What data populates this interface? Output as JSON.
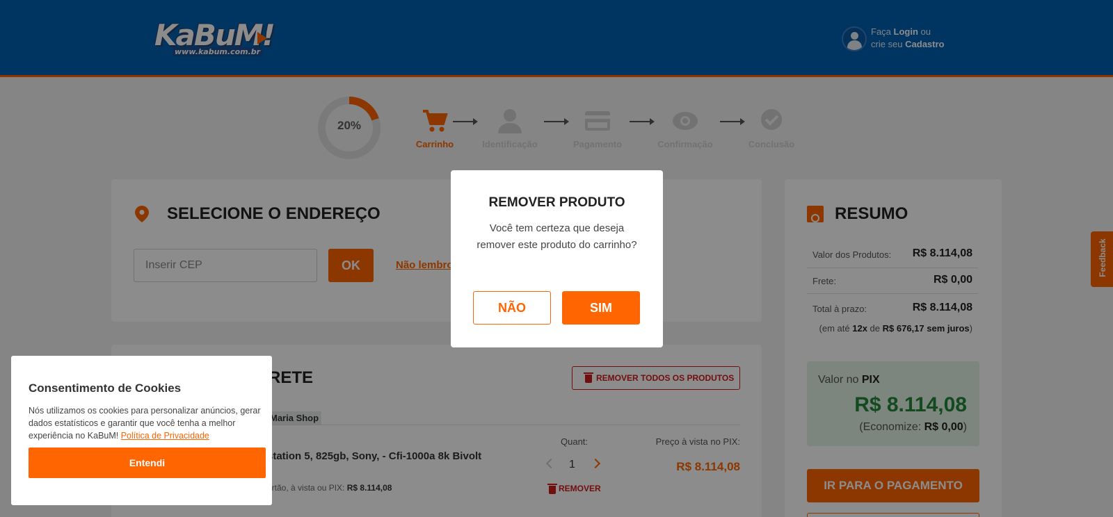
{
  "header": {
    "logo_text": "KaBuM!",
    "logo_url": "www.kabum.com.br",
    "login_prefix": "Faça ",
    "login_link": "Login",
    "login_mid": " ou",
    "login_line2_prefix": "crie seu ",
    "signup_link": "Cadastro"
  },
  "progress": {
    "percent_label": "20%",
    "percent_value": 0.2,
    "steps": [
      {
        "label": "Carrinho",
        "icon": "cart-icon",
        "active": true
      },
      {
        "label": "Identificação",
        "icon": "user-icon",
        "active": false
      },
      {
        "label": "Pagamento",
        "icon": "card-icon",
        "active": false
      },
      {
        "label": "Confirmação",
        "icon": "eye-icon",
        "active": false
      },
      {
        "label": "Conclusão",
        "icon": "check-icon",
        "active": false
      }
    ]
  },
  "address": {
    "title": "SELECIONE O ENDEREÇO",
    "cep_placeholder": "Inserir CEP",
    "ok_label": "OK",
    "forgot_link": "Não lembro"
  },
  "cart": {
    "title_partial": "RETE",
    "remove_all_label": "REMOVER TODOS OS PRODUTOS",
    "seller": "Maria Shop",
    "product_name": "station 5, 825gb, Sony, - Cfi-1000a 8k Bivolt",
    "product_sub_prefix": "artão, à vista ou PIX: ",
    "product_sub_value": "R$ 8.114,08",
    "quant_label": "Quant:",
    "quantity": "1",
    "remove_label": "REMOVER",
    "pix_price_label": "Preço à vista no PIX:",
    "pix_price": "R$ 8.114,08"
  },
  "summary": {
    "title": "RESUMO",
    "products_label": "Valor dos Produtos:",
    "products_value": "R$ 8.114,08",
    "shipping_label": "Frete:",
    "shipping_value": "R$ 0,00",
    "total_label": "Total à prazo:",
    "total_value": "R$ 8.114,08",
    "installments_prefix": "(em até ",
    "installments_count": "12x",
    "installments_mid": " de ",
    "installments_value": "R$ 676,17 sem juros",
    "installments_suffix": ")",
    "pix_label_prefix": "Valor no ",
    "pix_label_bold": "PIX",
    "pix_value": "R$ 8.114,08",
    "savings_prefix": "(Economize: ",
    "savings_value": "R$ 0,00",
    "savings_suffix": ")",
    "pay_button": "IR PARA O PAGAMENTO"
  },
  "feedback_label": "Feedback",
  "cookie": {
    "title": "Consentimento de Cookies",
    "text": "Nós utilizamos os cookies para personalizar anúncios, gerar dados estatísticos e garantir que você tenha a melhor experiência no KaBuM! ",
    "policy_link": "Política de Privacidade",
    "button": "Entendi"
  },
  "modal": {
    "title": "REMOVER PRODUTO",
    "message": "Você tem certeza que deseja remover este produto do carrinho?",
    "no_label": "NÃO",
    "yes_label": "SIM"
  },
  "colors": {
    "brand_blue": "#0060b1",
    "brand_orange": "#ff6500",
    "danger_red": "#d21a1a",
    "pix_green": "#24873a"
  }
}
